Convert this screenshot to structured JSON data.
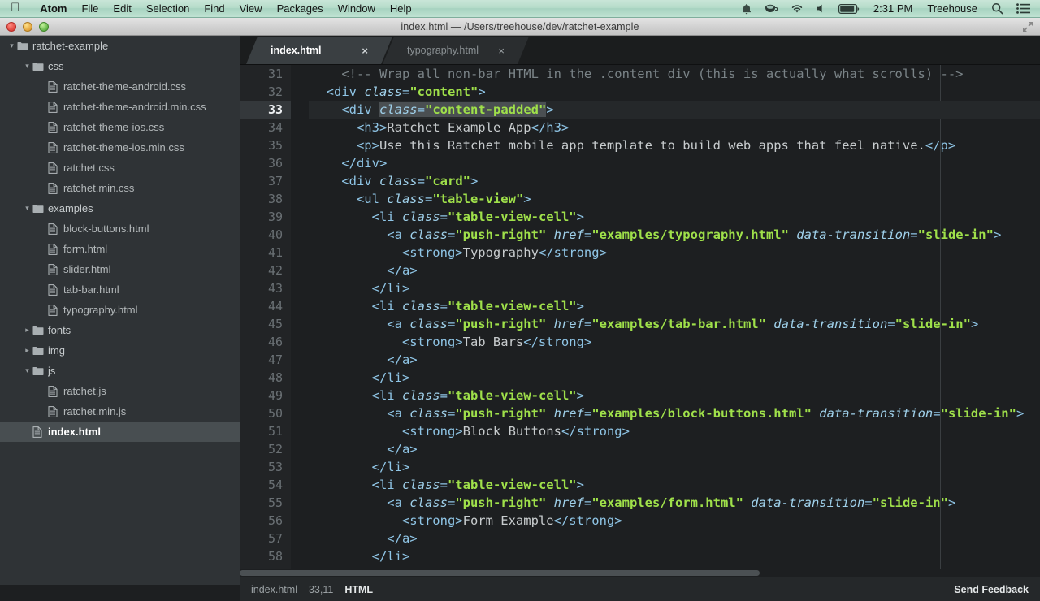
{
  "menubar": {
    "apple_icon": "apple-logo",
    "items": [
      "Atom",
      "File",
      "Edit",
      "Selection",
      "Find",
      "View",
      "Packages",
      "Window",
      "Help"
    ],
    "status_icons": [
      "bell-icon",
      "coffee-icon",
      "wifi-icon",
      "volume-icon",
      "battery-icon"
    ],
    "clock": "2:31 PM",
    "user": "Treehouse",
    "search_icon": "search-icon",
    "notification_center_icon": "list-icon"
  },
  "titlebar": {
    "title": "index.html — /Users/treehouse/dev/ratchet-example",
    "close_button": "close-window",
    "minimize_button": "minimize-window",
    "zoom_button": "zoom-window",
    "fullscreen_icon": "fullscreen-icon"
  },
  "tree": {
    "rows": [
      {
        "label": "ratchet-example",
        "depth": 0,
        "type": "folder",
        "twisty": "▾",
        "selected": false
      },
      {
        "label": "css",
        "depth": 1,
        "type": "folder",
        "twisty": "▾",
        "selected": false
      },
      {
        "label": "ratchet-theme-android.css",
        "depth": 2,
        "type": "file",
        "twisty": "",
        "selected": false
      },
      {
        "label": "ratchet-theme-android.min.css",
        "depth": 2,
        "type": "file",
        "twisty": "",
        "selected": false
      },
      {
        "label": "ratchet-theme-ios.css",
        "depth": 2,
        "type": "file",
        "twisty": "",
        "selected": false
      },
      {
        "label": "ratchet-theme-ios.min.css",
        "depth": 2,
        "type": "file",
        "twisty": "",
        "selected": false
      },
      {
        "label": "ratchet.css",
        "depth": 2,
        "type": "file",
        "twisty": "",
        "selected": false
      },
      {
        "label": "ratchet.min.css",
        "depth": 2,
        "type": "file",
        "twisty": "",
        "selected": false
      },
      {
        "label": "examples",
        "depth": 1,
        "type": "folder",
        "twisty": "▾",
        "selected": false
      },
      {
        "label": "block-buttons.html",
        "depth": 2,
        "type": "file",
        "twisty": "",
        "selected": false
      },
      {
        "label": "form.html",
        "depth": 2,
        "type": "file",
        "twisty": "",
        "selected": false
      },
      {
        "label": "slider.html",
        "depth": 2,
        "type": "file",
        "twisty": "",
        "selected": false
      },
      {
        "label": "tab-bar.html",
        "depth": 2,
        "type": "file",
        "twisty": "",
        "selected": false
      },
      {
        "label": "typography.html",
        "depth": 2,
        "type": "file",
        "twisty": "",
        "selected": false
      },
      {
        "label": "fonts",
        "depth": 1,
        "type": "folder",
        "twisty": "▸",
        "selected": false
      },
      {
        "label": "img",
        "depth": 1,
        "type": "folder",
        "twisty": "▸",
        "selected": false
      },
      {
        "label": "js",
        "depth": 1,
        "type": "folder",
        "twisty": "▾",
        "selected": false
      },
      {
        "label": "ratchet.js",
        "depth": 2,
        "type": "file",
        "twisty": "",
        "selected": false
      },
      {
        "label": "ratchet.min.js",
        "depth": 2,
        "type": "file",
        "twisty": "",
        "selected": false
      },
      {
        "label": "index.html",
        "depth": 1,
        "type": "file",
        "twisty": "",
        "selected": true
      }
    ]
  },
  "tabs": [
    {
      "label": "index.html",
      "active": true,
      "close_icon": "×"
    },
    {
      "label": "typography.html",
      "active": false,
      "close_icon": "×"
    }
  ],
  "editor": {
    "active_line": 33,
    "first_line": 31,
    "lines": [
      {
        "n": 31,
        "indent": 2,
        "tokens": [
          {
            "t": "comment",
            "v": "<!-- Wrap all non-bar HTML in the .content div (this is actually what scrolls) -->"
          }
        ]
      },
      {
        "n": 32,
        "indent": 1,
        "tokens": [
          {
            "t": "tag",
            "v": "<div "
          },
          {
            "t": "attr",
            "v": "class"
          },
          {
            "t": "eq",
            "v": "="
          },
          {
            "t": "str",
            "v": "\"content\""
          },
          {
            "t": "tag",
            "v": ">"
          }
        ]
      },
      {
        "n": 33,
        "indent": 2,
        "tokens": [
          {
            "t": "tag",
            "v": "<div "
          },
          {
            "t": "attr",
            "v": "class",
            "sel": true
          },
          {
            "t": "eq",
            "v": "=",
            "sel": true
          },
          {
            "t": "str",
            "v": "\"content-padded\"",
            "sel": true
          },
          {
            "t": "tag",
            "v": ">"
          }
        ]
      },
      {
        "n": 34,
        "indent": 3,
        "tokens": [
          {
            "t": "tag",
            "v": "<h3>"
          },
          {
            "t": "text",
            "v": "Ratchet Example App"
          },
          {
            "t": "tag",
            "v": "</h3>"
          }
        ]
      },
      {
        "n": 35,
        "indent": 3,
        "tokens": [
          {
            "t": "tag",
            "v": "<p>"
          },
          {
            "t": "text",
            "v": "Use this Ratchet mobile app template to build web apps that feel native."
          },
          {
            "t": "tag",
            "v": "</p>"
          }
        ]
      },
      {
        "n": 36,
        "indent": 2,
        "tokens": [
          {
            "t": "tag",
            "v": "</div>"
          }
        ]
      },
      {
        "n": 37,
        "indent": 2,
        "tokens": [
          {
            "t": "tag",
            "v": "<div "
          },
          {
            "t": "attr",
            "v": "class"
          },
          {
            "t": "eq",
            "v": "="
          },
          {
            "t": "str",
            "v": "\"card\""
          },
          {
            "t": "tag",
            "v": ">"
          }
        ]
      },
      {
        "n": 38,
        "indent": 3,
        "tokens": [
          {
            "t": "tag",
            "v": "<ul "
          },
          {
            "t": "attr",
            "v": "class"
          },
          {
            "t": "eq",
            "v": "="
          },
          {
            "t": "str",
            "v": "\"table-view\""
          },
          {
            "t": "tag",
            "v": ">"
          }
        ]
      },
      {
        "n": 39,
        "indent": 4,
        "tokens": [
          {
            "t": "tag",
            "v": "<li "
          },
          {
            "t": "attr",
            "v": "class"
          },
          {
            "t": "eq",
            "v": "="
          },
          {
            "t": "str",
            "v": "\"table-view-cell\""
          },
          {
            "t": "tag",
            "v": ">"
          }
        ]
      },
      {
        "n": 40,
        "indent": 5,
        "tokens": [
          {
            "t": "tag",
            "v": "<a "
          },
          {
            "t": "attr",
            "v": "class"
          },
          {
            "t": "eq",
            "v": "="
          },
          {
            "t": "str",
            "v": "\"push-right\""
          },
          {
            "t": "tag",
            "v": " "
          },
          {
            "t": "attr",
            "v": "href"
          },
          {
            "t": "eq",
            "v": "="
          },
          {
            "t": "str",
            "v": "\"examples/typography.html\""
          },
          {
            "t": "tag",
            "v": " "
          },
          {
            "t": "attr",
            "v": "data-transition"
          },
          {
            "t": "eq",
            "v": "="
          },
          {
            "t": "str",
            "v": "\"slide-in\""
          },
          {
            "t": "tag",
            "v": ">"
          }
        ]
      },
      {
        "n": 41,
        "indent": 6,
        "tokens": [
          {
            "t": "tag",
            "v": "<strong>"
          },
          {
            "t": "text",
            "v": "Typography"
          },
          {
            "t": "tag",
            "v": "</strong>"
          }
        ]
      },
      {
        "n": 42,
        "indent": 5,
        "tokens": [
          {
            "t": "tag",
            "v": "</a>"
          }
        ]
      },
      {
        "n": 43,
        "indent": 4,
        "tokens": [
          {
            "t": "tag",
            "v": "</li>"
          }
        ]
      },
      {
        "n": 44,
        "indent": 4,
        "tokens": [
          {
            "t": "tag",
            "v": "<li "
          },
          {
            "t": "attr",
            "v": "class"
          },
          {
            "t": "eq",
            "v": "="
          },
          {
            "t": "str",
            "v": "\"table-view-cell\""
          },
          {
            "t": "tag",
            "v": ">"
          }
        ]
      },
      {
        "n": 45,
        "indent": 5,
        "tokens": [
          {
            "t": "tag",
            "v": "<a "
          },
          {
            "t": "attr",
            "v": "class"
          },
          {
            "t": "eq",
            "v": "="
          },
          {
            "t": "str",
            "v": "\"push-right\""
          },
          {
            "t": "tag",
            "v": " "
          },
          {
            "t": "attr",
            "v": "href"
          },
          {
            "t": "eq",
            "v": "="
          },
          {
            "t": "str",
            "v": "\"examples/tab-bar.html\""
          },
          {
            "t": "tag",
            "v": " "
          },
          {
            "t": "attr",
            "v": "data-transition"
          },
          {
            "t": "eq",
            "v": "="
          },
          {
            "t": "str",
            "v": "\"slide-in\""
          },
          {
            "t": "tag",
            "v": ">"
          }
        ]
      },
      {
        "n": 46,
        "indent": 6,
        "tokens": [
          {
            "t": "tag",
            "v": "<strong>"
          },
          {
            "t": "text",
            "v": "Tab Bars"
          },
          {
            "t": "tag",
            "v": "</strong>"
          }
        ]
      },
      {
        "n": 47,
        "indent": 5,
        "tokens": [
          {
            "t": "tag",
            "v": "</a>"
          }
        ]
      },
      {
        "n": 48,
        "indent": 4,
        "tokens": [
          {
            "t": "tag",
            "v": "</li>"
          }
        ]
      },
      {
        "n": 49,
        "indent": 4,
        "tokens": [
          {
            "t": "tag",
            "v": "<li "
          },
          {
            "t": "attr",
            "v": "class"
          },
          {
            "t": "eq",
            "v": "="
          },
          {
            "t": "str",
            "v": "\"table-view-cell\""
          },
          {
            "t": "tag",
            "v": ">"
          }
        ]
      },
      {
        "n": 50,
        "indent": 5,
        "tokens": [
          {
            "t": "tag",
            "v": "<a "
          },
          {
            "t": "attr",
            "v": "class"
          },
          {
            "t": "eq",
            "v": "="
          },
          {
            "t": "str",
            "v": "\"push-right\""
          },
          {
            "t": "tag",
            "v": " "
          },
          {
            "t": "attr",
            "v": "href"
          },
          {
            "t": "eq",
            "v": "="
          },
          {
            "t": "str",
            "v": "\"examples/block-buttons.html\""
          },
          {
            "t": "tag",
            "v": " "
          },
          {
            "t": "attr",
            "v": "data-transition"
          },
          {
            "t": "eq",
            "v": "="
          },
          {
            "t": "str",
            "v": "\"slide-in\""
          },
          {
            "t": "tag",
            "v": ">"
          }
        ]
      },
      {
        "n": 51,
        "indent": 6,
        "tokens": [
          {
            "t": "tag",
            "v": "<strong>"
          },
          {
            "t": "text",
            "v": "Block Buttons"
          },
          {
            "t": "tag",
            "v": "</strong>"
          }
        ]
      },
      {
        "n": 52,
        "indent": 5,
        "tokens": [
          {
            "t": "tag",
            "v": "</a>"
          }
        ]
      },
      {
        "n": 53,
        "indent": 4,
        "tokens": [
          {
            "t": "tag",
            "v": "</li>"
          }
        ]
      },
      {
        "n": 54,
        "indent": 4,
        "tokens": [
          {
            "t": "tag",
            "v": "<li "
          },
          {
            "t": "attr",
            "v": "class"
          },
          {
            "t": "eq",
            "v": "="
          },
          {
            "t": "str",
            "v": "\"table-view-cell\""
          },
          {
            "t": "tag",
            "v": ">"
          }
        ]
      },
      {
        "n": 55,
        "indent": 5,
        "tokens": [
          {
            "t": "tag",
            "v": "<a "
          },
          {
            "t": "attr",
            "v": "class"
          },
          {
            "t": "eq",
            "v": "="
          },
          {
            "t": "str",
            "v": "\"push-right\""
          },
          {
            "t": "tag",
            "v": " "
          },
          {
            "t": "attr",
            "v": "href"
          },
          {
            "t": "eq",
            "v": "="
          },
          {
            "t": "str",
            "v": "\"examples/form.html\""
          },
          {
            "t": "tag",
            "v": " "
          },
          {
            "t": "attr",
            "v": "data-transition"
          },
          {
            "t": "eq",
            "v": "="
          },
          {
            "t": "str",
            "v": "\"slide-in\""
          },
          {
            "t": "tag",
            "v": ">"
          }
        ]
      },
      {
        "n": 56,
        "indent": 6,
        "tokens": [
          {
            "t": "tag",
            "v": "<strong>"
          },
          {
            "t": "text",
            "v": "Form Example"
          },
          {
            "t": "tag",
            "v": "</strong>"
          }
        ]
      },
      {
        "n": 57,
        "indent": 5,
        "tokens": [
          {
            "t": "tag",
            "v": "</a>"
          }
        ]
      },
      {
        "n": 58,
        "indent": 4,
        "tokens": [
          {
            "t": "tag",
            "v": "</li>"
          }
        ]
      }
    ]
  },
  "statusbar": {
    "filename": "index.html",
    "cursor": "33,11",
    "grammar": "HTML",
    "feedback": "Send Feedback"
  },
  "colors": {
    "menubar_bg": "#b6dcca",
    "tree_bg": "#2f3336",
    "editor_bg": "#1d1f21",
    "tag": "#8fc5e6",
    "string": "#9fe04a",
    "comment": "#7a8387",
    "text": "#c8ccce",
    "selection": "#4a4f52"
  }
}
